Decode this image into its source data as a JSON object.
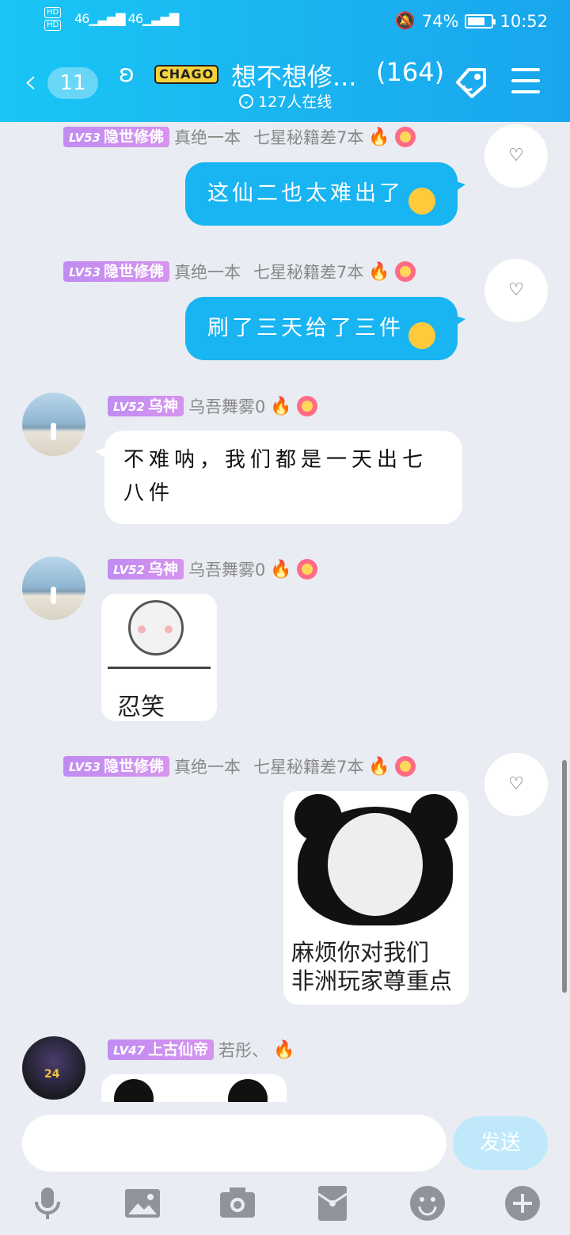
{
  "status_bar": {
    "hd1": "HD",
    "hd2": "HD",
    "signal1": "46",
    "signal2": "46",
    "battery": "74%",
    "time": "10:52",
    "battery_level": 0.74
  },
  "header": {
    "back_count": "11",
    "brand": "CHAGO",
    "title": "想不想修...",
    "member_count": "(164)",
    "online": "127人在线"
  },
  "messages": [
    {
      "level": "LV53",
      "badge": "隐世修佛",
      "name": "真绝一本",
      "title": "七星秘籍差7本",
      "text": "这仙二也太难出了"
    },
    {
      "level": "LV53",
      "badge": "隐世修佛",
      "name": "真绝一本",
      "title": "七星秘籍差7本",
      "text": "刷了三天给了三件"
    },
    {
      "level": "LV52",
      "badge": "乌神",
      "name": "乌吾舞雾0",
      "text": "不难呐，我们都是一天出七八件"
    },
    {
      "level": "LV52",
      "badge": "乌神",
      "name": "乌吾舞雾0",
      "sticker_caption": "忍笑"
    },
    {
      "level": "LV53",
      "badge": "隐世修佛",
      "name": "真绝一本",
      "title": "七星秘籍差7本",
      "sticker_caption_line1": "麻烦你对我们",
      "sticker_caption_line2": "非洲玩家尊重点"
    },
    {
      "level": "LV47",
      "badge": "上古仙帝",
      "name": "若彤、"
    }
  ],
  "input": {
    "placeholder": "",
    "send_label": "发送"
  },
  "colors": {
    "header": "#19b4f2",
    "bubble_blue": "#19b4f2",
    "badge": "#c98cf0",
    "background": "#e9ecf2"
  }
}
